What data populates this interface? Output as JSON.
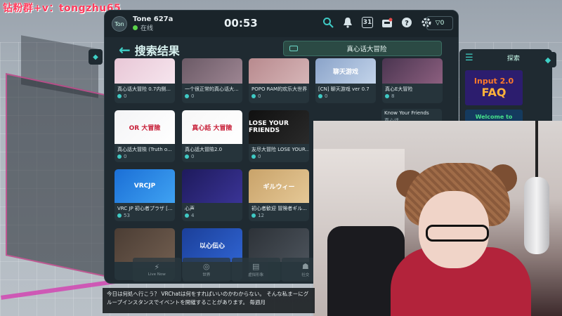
{
  "watermark": "钻粉群+v：tongzhu65",
  "topbar": {
    "avatar_initials": "Ton",
    "user_name": "Tone 627a",
    "status": "在线",
    "clock": "00:53",
    "credits": "▽0",
    "calendar_day": "31"
  },
  "search": {
    "title": "搜索结果",
    "query": "真心话大冒险"
  },
  "cards": [
    {
      "title": "真心话大冒险 0.7内侧...",
      "count": "0",
      "color_a": "#e8c7d6",
      "color_b": "#f6e5ee",
      "thumb_text": ""
    },
    {
      "title": "一个很正常的真心话大...",
      "count": "0",
      "color_a": "#6b5a66",
      "color_b": "#9d8592",
      "thumb_text": ""
    },
    {
      "title": "POPO RAM的欢乐大世界",
      "count": "0",
      "color_a": "#b88a8e",
      "color_b": "#d6b5b7",
      "thumb_text": ""
    },
    {
      "title": "[CN] 聊天游戏 ver 0.7",
      "count": "0",
      "color_a": "#8aa3c9",
      "color_b": "#c3d4ea",
      "thumb_text": "聊天游戏"
    },
    {
      "title": "真心E大冒险",
      "count": "8",
      "color_a": "#4a3550",
      "color_b": "#8c5f7f",
      "thumb_text": ""
    },
    {
      "title": "真心話大冒險 (Truth o...",
      "count": "0",
      "color_a": "#f4f4f6",
      "color_b": "#ffffff",
      "thumb_text": "OR 大冒險"
    },
    {
      "title": "真心話大冒險2.0",
      "count": "0",
      "color_a": "#f7f7f7",
      "color_b": "#ffffff",
      "thumb_text": "真心話 大冒險"
    },
    {
      "title": "友尽大冒险 LOSE YOUR...",
      "count": "0",
      "color_a": "#101010",
      "color_b": "#2a2a2a",
      "thumb_text": "LOSE YOUR FRIENDS"
    },
    {
      "title": "VRC JP 初心者プラザ [...",
      "count": "53",
      "color_a": "#1b6fd6",
      "color_b": "#3fa2f2",
      "thumb_text": "VRCJP"
    },
    {
      "title": "心声",
      "count": "4",
      "color_a": "#1e1a5c",
      "color_b": "#3a3496",
      "thumb_text": ""
    },
    {
      "title": "初心者歓迎 冒険者ギル...",
      "count": "12",
      "color_a": "#c9a36a",
      "color_b": "#e5c896",
      "thumb_text": "ギルウィー"
    },
    {
      "title": "",
      "count": "",
      "color_a": "#4b3d34",
      "color_b": "#6f5c4e",
      "thumb_text": ""
    },
    {
      "title": "",
      "count": "",
      "color_a": "#1b3f99",
      "color_b": "#2f63d0",
      "thumb_text": "以心伝心"
    },
    {
      "title": "",
      "count": "",
      "color_a": "#2d3238",
      "color_b": "#4b525a",
      "thumb_text": ""
    }
  ],
  "partial_card": {
    "title": "Know Your Friends",
    "subtitle": "真心话"
  },
  "bottom_nav": [
    {
      "icon": "⚡",
      "label": "Live Now"
    },
    {
      "icon": "◎",
      "label": "世界"
    },
    {
      "icon": "▤",
      "label": "虚拟形象"
    },
    {
      "icon": "☗",
      "label": "社交"
    }
  ],
  "right_panel": {
    "title": "探索",
    "banner_line1": "Input 2.0",
    "banner_line2": "FAQ",
    "welcome": "Welcome to"
  },
  "caption": "今日は何処へ行こう？ VRChatは何をすればいいのかわからない。 そんな私まーにグループインスタンスでイベントを開催することがあります。 毎週月"
}
